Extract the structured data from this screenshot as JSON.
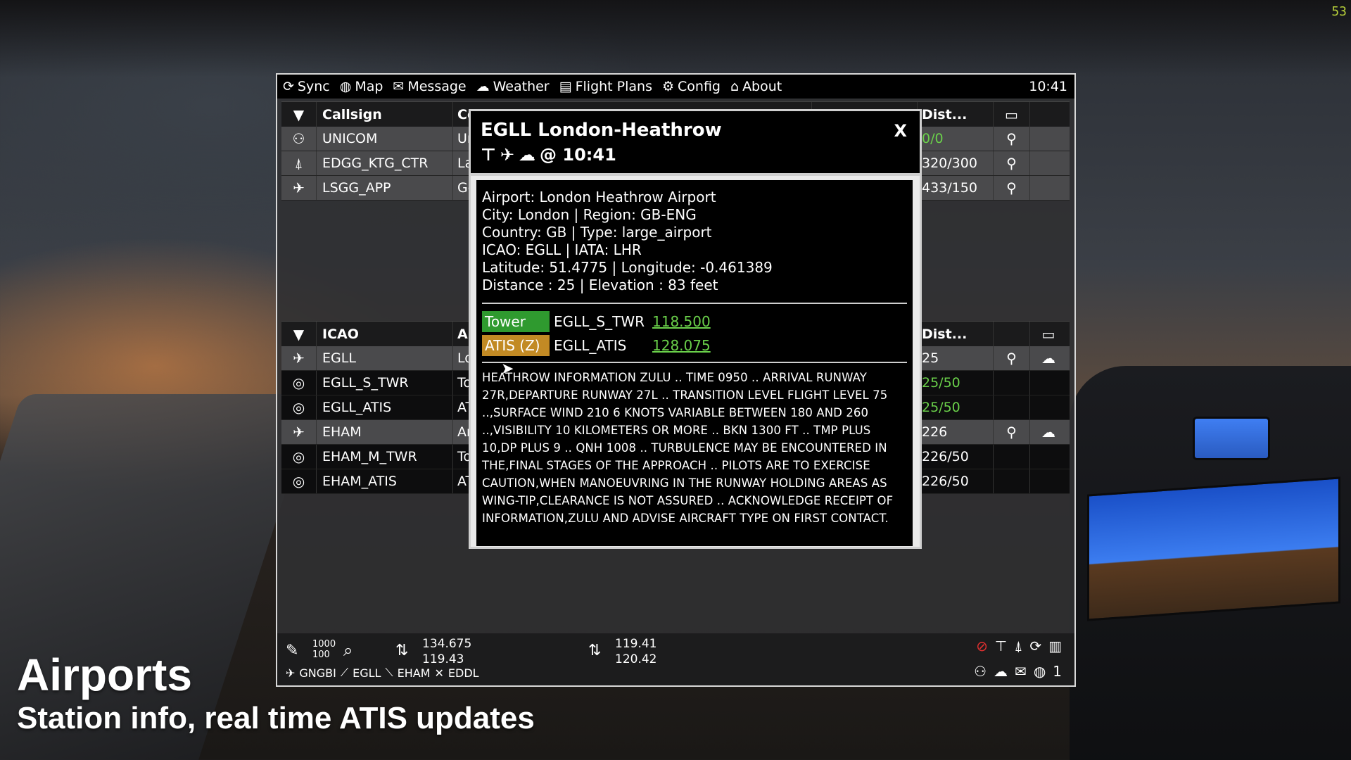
{
  "fps": "53",
  "menu": {
    "items": [
      {
        "label": "Sync",
        "icon": "sync-icon",
        "glyph": "⟳"
      },
      {
        "label": "Map",
        "icon": "globe-icon",
        "glyph": "🌐"
      },
      {
        "label": "Message",
        "icon": "envelope-icon",
        "glyph": "✉"
      },
      {
        "label": "Weather",
        "icon": "weather-icon",
        "glyph": "⛈"
      },
      {
        "label": "Flight Plans",
        "icon": "clipboard-icon",
        "glyph": "📋"
      },
      {
        "label": "Config",
        "icon": "gear-icon",
        "glyph": "⚙"
      },
      {
        "label": "About",
        "icon": "home-icon",
        "glyph": "⌂"
      }
    ],
    "clock": "10:41"
  },
  "controllers": {
    "headers": {
      "callsign": "Callsign",
      "b": "Co",
      "dist": "Dist..."
    },
    "rows": [
      {
        "icon": "unicom-icon",
        "glyph": "👥",
        "callsign": "UNICOM",
        "b": "Ur",
        "dist": "0/0",
        "green": true
      },
      {
        "icon": "tower-antenna-icon",
        "glyph": "📡",
        "callsign": "EDGG_KTG_CTR",
        "b": "La",
        "dist": "320/300",
        "green": false
      },
      {
        "icon": "approach-icon",
        "glyph": "🛬",
        "callsign": "LSGG_APP",
        "b": "Ge",
        "dist": "433/150",
        "green": false
      }
    ]
  },
  "airports": {
    "headers": {
      "icao": "ICAO",
      "b": "Ai",
      "dist": "Dist..."
    },
    "rows": [
      {
        "type": "airport",
        "icon": "airport-icon",
        "glyph": "✈",
        "name": "EGLL",
        "b": "Lo",
        "dist": "25",
        "green": false
      },
      {
        "type": "station",
        "icon": "headset-icon",
        "glyph": "🎧",
        "name": "EGLL_S_TWR",
        "b": "To",
        "dist": "25/50",
        "green": true
      },
      {
        "type": "station",
        "icon": "headset-icon",
        "glyph": "🎧",
        "name": "EGLL_ATIS",
        "b": "AT",
        "dist": "25/50",
        "green": true
      },
      {
        "type": "airport",
        "icon": "airport-icon",
        "glyph": "✈",
        "name": "EHAM",
        "b": "Am",
        "dist": "226",
        "green": false
      },
      {
        "type": "station",
        "icon": "headset-icon",
        "glyph": "🎧",
        "name": "EHAM_M_TWR",
        "b": "To",
        "dist": "226/50",
        "green": false
      },
      {
        "type": "station",
        "icon": "headset-icon",
        "glyph": "🎧",
        "name": "EHAM_ATIS",
        "b": "AT",
        "dist": "226/50",
        "green": false
      }
    ]
  },
  "bottom": {
    "range_top": "1000",
    "range_bottom": "100",
    "com1_active": "134.675",
    "com1_standby": "119.43",
    "com2_active": "119.41",
    "com2_standby": "120.42",
    "route": [
      {
        "icon": "plane-icon",
        "glyph": "✈",
        "label": "GNGBI"
      },
      {
        "icon": "departure-icon",
        "glyph": "🛫",
        "label": "EGLL"
      },
      {
        "icon": "arrival-icon",
        "glyph": "🛬",
        "label": "EHAM"
      },
      {
        "icon": "alternate-icon",
        "glyph": "✈",
        "label": "EDDL"
      }
    ],
    "count": "1"
  },
  "popup": {
    "title": "EGLL London-Heathrow",
    "sub_time": "@ 10:41",
    "close": "X",
    "info": [
      "Airport: London Heathrow Airport",
      "City: London | Region: GB-ENG",
      "Country: GB | Type: large_airport",
      "ICAO: EGLL | IATA: LHR",
      "Latitude: 51.4775 | Longitude: -0.461389",
      "Distance : 25 | Elevation : 83 feet"
    ],
    "frequencies": [
      {
        "badge": "Tower",
        "kind": "tower",
        "station": "EGLL_S_TWR",
        "freq": "118.500"
      },
      {
        "badge": "ATIS (Z)",
        "kind": "atis",
        "station": "EGLL_ATIS",
        "freq": "128.075"
      }
    ],
    "atis": "HEATHROW INFORMATION ZULU .. TIME 0950 .. ARRIVAL RUNWAY 27R,DEPARTURE RUNWAY 27L .. TRANSITION LEVEL FLIGHT LEVEL 75 ..,SURFACE WIND 210 6 KNOTS VARIABLE BETWEEN 180 AND 260 ..,VISIBILITY 10 KILOMETERS OR MORE .. BKN 1300 FT .. TMP PLUS 10,DP PLUS 9 .. QNH 1008 .. TURBULENCE MAY BE ENCOUNTERED IN THE,FINAL STAGES OF THE APPROACH .. PILOTS ARE TO EXERCISE CAUTION,WHEN MANOEUVRING IN THE RUNWAY HOLDING AREAS AS WING-TIP,CLEARANCE IS NOT ASSURED .. ACKNOWLEDGE RECEIPT OF INFORMATION,ZULU AND ADVISE AIRCRAFT TYPE ON FIRST CONTACT."
  },
  "caption": {
    "title": "Airports",
    "subtitle": "Station info, real time ATIS updates"
  }
}
